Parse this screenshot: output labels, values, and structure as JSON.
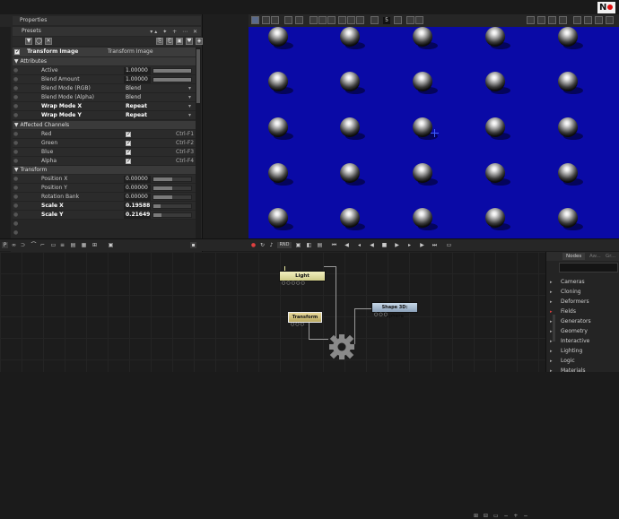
{
  "logo": "N",
  "properties": {
    "title": "Properties",
    "presets_label": "Presets",
    "node_name": "Transform Image",
    "node_type": "Transform Image",
    "sections": {
      "attributes": "Attributes",
      "affected": "Affected Channels",
      "transform": "Transform"
    },
    "attributes": [
      {
        "label": "Active",
        "value": "1.00000",
        "fill": 1.0
      },
      {
        "label": "Blend Amount",
        "value": "1.00000",
        "fill": 1.0
      },
      {
        "label": "Blend Mode (RGB)",
        "value": "Blend"
      },
      {
        "label": "Blend Mode (Alpha)",
        "value": "Blend"
      },
      {
        "label": "Wrap Mode X",
        "value": "Repeat"
      },
      {
        "label": "Wrap Mode Y",
        "value": "Repeat"
      }
    ],
    "channels": [
      {
        "label": "Red",
        "shortcut": "Ctrl-F1"
      },
      {
        "label": "Green",
        "shortcut": "Ctrl-F2"
      },
      {
        "label": "Blue",
        "shortcut": "Ctrl-F3"
      },
      {
        "label": "Alpha",
        "shortcut": "Ctrl-F4"
      }
    ],
    "transform": [
      {
        "label": "Position X",
        "value": "0.00000",
        "fill": 0.5
      },
      {
        "label": "Position Y",
        "value": "0.00000",
        "fill": 0.5
      },
      {
        "label": "Rotation Bank",
        "value": "0.00000",
        "fill": 0.5
      },
      {
        "label": "Scale X",
        "value": "0.19588",
        "fill": 0.2
      },
      {
        "label": "Scale Y",
        "value": "0.21649",
        "fill": 0.22
      }
    ]
  },
  "viewer": {
    "frame": "5",
    "background_color": "#0a0aa6"
  },
  "transport": {
    "render_label": "RND"
  },
  "graph": {
    "nodes": [
      {
        "label": "Light"
      },
      {
        "label": "Transform I..."
      },
      {
        "label": "Shape 3D: Sphere"
      }
    ]
  },
  "nodes_panel": {
    "tabs": [
      "Nodes",
      "Aw...",
      "Gr..."
    ],
    "items": [
      "Cameras",
      "Cloning",
      "Deformers",
      "Fields",
      "Generators",
      "Geometry",
      "Interactive",
      "Lighting",
      "Logic",
      "Materials"
    ]
  }
}
